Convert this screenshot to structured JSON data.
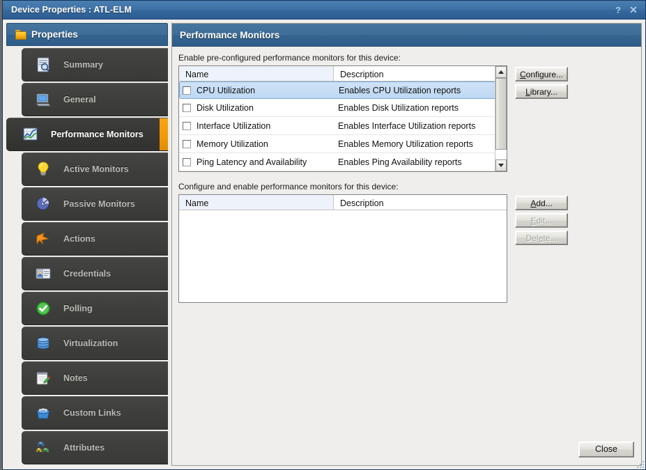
{
  "window": {
    "title": "Device Properties : ATL-ELM",
    "help_label": "?",
    "close_label": "✕"
  },
  "sidebar": {
    "header": "Properties",
    "header_icon": "folder-icon",
    "items": [
      {
        "label": "Summary",
        "icon": "summary-report-icon",
        "selected": false
      },
      {
        "label": "General",
        "icon": "computer-monitor-icon",
        "selected": false
      },
      {
        "label": "Performance Monitors",
        "icon": "line-chart-icon",
        "selected": true
      },
      {
        "label": "Active Monitors",
        "icon": "lightbulb-icon",
        "selected": false
      },
      {
        "label": "Passive Monitors",
        "icon": "satellite-dish-icon",
        "selected": false
      },
      {
        "label": "Actions",
        "icon": "orange-arrow-icon",
        "selected": false
      },
      {
        "label": "Credentials",
        "icon": "id-card-icon",
        "selected": false
      },
      {
        "label": "Polling",
        "icon": "green-check-icon",
        "selected": false
      },
      {
        "label": "Virtualization",
        "icon": "blue-stack-icon",
        "selected": false
      },
      {
        "label": "Notes",
        "icon": "notepad-pencil-icon",
        "selected": false
      },
      {
        "label": "Custom Links",
        "icon": "blue-bucket-icon",
        "selected": false
      },
      {
        "label": "Attributes",
        "icon": "colored-cubes-icon",
        "selected": false
      }
    ]
  },
  "main": {
    "header": "Performance Monitors",
    "preconfigured": {
      "label": "Enable pre-configured performance monitors for this device:",
      "columns": [
        "Name",
        "Description"
      ],
      "rows": [
        {
          "name": "CPU Utilization",
          "description": "Enables CPU Utilization reports",
          "checked": false,
          "selected": true
        },
        {
          "name": "Disk Utilization",
          "description": "Enables Disk Utilization reports",
          "checked": false,
          "selected": false
        },
        {
          "name": "Interface Utilization",
          "description": "Enables Interface Utilization reports",
          "checked": false,
          "selected": false
        },
        {
          "name": "Memory Utilization",
          "description": "Enables Memory Utilization reports",
          "checked": false,
          "selected": false
        },
        {
          "name": "Ping Latency and Availability",
          "description": "Enables Ping Availability reports",
          "checked": false,
          "selected": false
        }
      ],
      "buttons": [
        {
          "label": "Configure...",
          "mnemonic": "C",
          "enabled": true
        },
        {
          "label": "Library...",
          "mnemonic": "L",
          "enabled": true
        }
      ]
    },
    "configurable": {
      "label": "Configure and enable performance monitors for this device:",
      "columns": [
        "Name",
        "Description"
      ],
      "rows": [],
      "buttons": [
        {
          "label": "Add...",
          "mnemonic": "A",
          "enabled": true
        },
        {
          "label": "Edit...",
          "mnemonic": "E",
          "enabled": false
        },
        {
          "label": "Delete...",
          "mnemonic": "e",
          "enabled": false
        }
      ]
    }
  },
  "footer": {
    "close_label": "Close"
  },
  "colors": {
    "titlebar_blue": "#3d6d98",
    "accent_orange": "#f59b07",
    "sidebar_dark": "#3e3e3c",
    "selection_blue": "#bed8f3"
  }
}
